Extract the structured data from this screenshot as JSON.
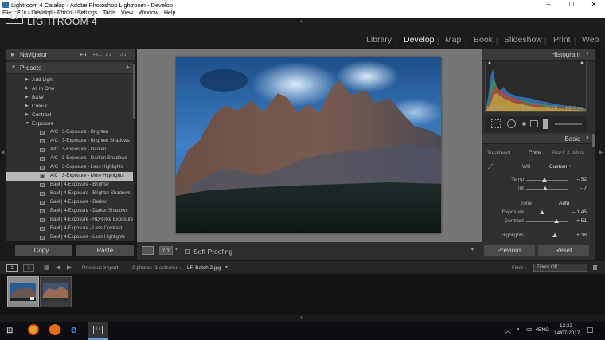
{
  "window": {
    "title": "Lightroom 4 Catalog - Adobe Photoshop Lightroom - Develop",
    "min": "–",
    "max": "☐",
    "close": "✕"
  },
  "menu": [
    "File",
    "Edit",
    "Develop",
    "Photo",
    "Settings",
    "Tools",
    "View",
    "Window",
    "Help"
  ],
  "brand": {
    "logo": "Lr",
    "top": "ADOBE PHOTOSHOP",
    "main": "LIGHTROOM 4"
  },
  "modules": [
    {
      "label": "Library",
      "active": false
    },
    {
      "label": "Develop",
      "active": true
    },
    {
      "label": "Map",
      "active": false
    },
    {
      "label": "Book",
      "active": false
    },
    {
      "label": "Slideshow",
      "active": false
    },
    {
      "label": "Print",
      "active": false
    },
    {
      "label": "Web",
      "active": false
    }
  ],
  "navigator": {
    "title": "Navigator",
    "options": [
      "FIT",
      "FILL",
      "1:1",
      "3:1"
    ],
    "selected": "FIT"
  },
  "presets": {
    "title": "Presets",
    "controls": [
      "–",
      "+"
    ],
    "folders_before": [
      "Add Light",
      "All in One",
      "B&W",
      "Colour",
      "Contrast",
      "Exposure"
    ],
    "items": [
      "A/C | 3-Exposure - Brighten",
      "A/C | 3-Exposure - Brighten Shadows",
      "A/C | 3-Exposure - Darken",
      "A/C | 3-Exposure - Darken Shadows",
      "A/C | 3-Exposure - Less Highlights",
      "A/C | 3-Exposure - More Highlights",
      "BaM | 4-Exposure - Brighter",
      "BaM | 4-Exposure - Brighter Shadows",
      "BaM | 4-Exposure - Darker",
      "BaM | 4-Exposure - Darker Shadows",
      "BaM | 4-Exposure - HDR-like Exposure",
      "BaM | 4-Exposure - Less Contrast",
      "BaM | 4-Exposure - Less Highlights"
    ],
    "selected_index": 5
  },
  "left_buttons": {
    "copy": "Copy...",
    "paste": "Paste"
  },
  "toolbar": {
    "soft_proofing": "Soft Proofing",
    "view_mode": "Y|Y"
  },
  "histogram": {
    "title": "Histogram",
    "info": [
      "ISO 200",
      "30 mm",
      "f / 2.8",
      "1/200 sec"
    ]
  },
  "basic": {
    "title": "Basic",
    "treatment_label": "Treatment :",
    "treatment_color": "Color",
    "treatment_bw": "Black & White",
    "wb_label": "WB :",
    "wb_value": "Custom ÷",
    "tone_label": "Tone",
    "auto_label": "Auto",
    "sliders": [
      {
        "label": "Temp",
        "value": "– 52",
        "pos": 0.45
      },
      {
        "label": "Tint",
        "value": "– 7",
        "pos": 0.47
      },
      {
        "label": "Exposure",
        "value": "– 1.45",
        "pos": 0.38
      },
      {
        "label": "Contrast",
        "value": "+ 51",
        "pos": 0.74
      },
      {
        "label": "Highlights",
        "value": "+ 38",
        "pos": 0.7
      }
    ]
  },
  "right_buttons": {
    "previous": "Previous",
    "reset": "Reset"
  },
  "filmbar": {
    "screens": [
      "1",
      "2"
    ],
    "source": "Previous Import",
    "info": "2 photos /1 selected /",
    "filename": "LR Batch 2.jpg",
    "filter_label": "Filter :",
    "filter_value": "Filters Off"
  },
  "taskbar": {
    "language": "ENG",
    "time": "12:23",
    "date": "14/07/2017"
  }
}
